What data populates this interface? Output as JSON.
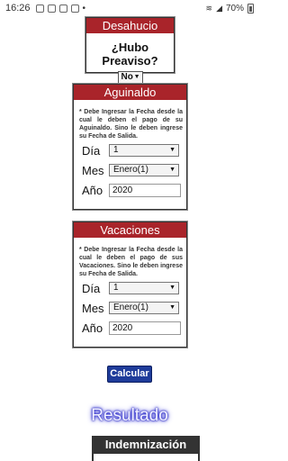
{
  "status_bar": {
    "time": "16:26",
    "battery": "70%"
  },
  "desahucio": {
    "title": "Desahucio",
    "question": "¿Hubo Preaviso?",
    "select_value": "No"
  },
  "aguinaldo": {
    "title": "Aguinaldo",
    "note": "* Debe Ingresar la Fecha desde la cual le deben el pago de su Aguinaldo. Sino le deben ingrese su Fecha de Salida.",
    "dia_label": "Día",
    "dia_value": "1",
    "mes_label": "Mes",
    "mes_value": "Enero(1)",
    "anio_label": "Año",
    "anio_value": "2020"
  },
  "vacaciones": {
    "title": "Vacaciones",
    "note": "* Debe Ingresar la Fecha desde la cual le deben el pago de sus Vacaciones. Sino le deben ingrese su Fecha de Salida.",
    "dia_label": "Día",
    "dia_value": "1",
    "mes_label": "Mes",
    "mes_value": "Enero(1)",
    "anio_label": "Año",
    "anio_value": "2020"
  },
  "calcular_label": "Calcular",
  "resultado_title": "Resultado",
  "table_header": "Indemnización"
}
